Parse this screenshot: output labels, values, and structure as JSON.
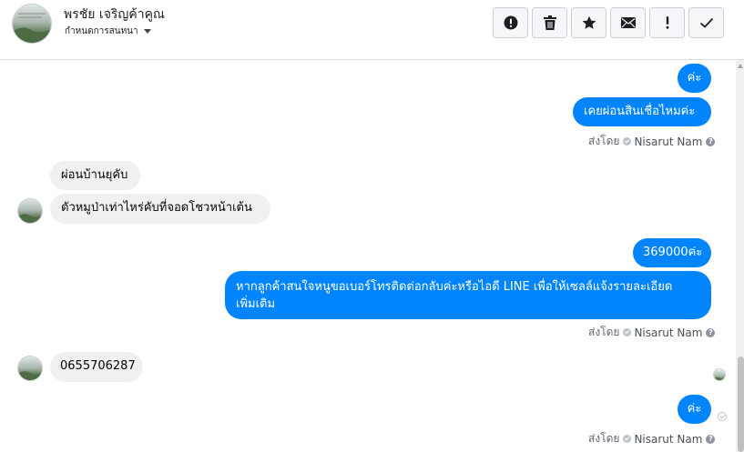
{
  "header": {
    "contact_name": "พรชัย เจริญค้าคูณ",
    "assign_label": "กำหนดการสนทนา",
    "toolbar": [
      {
        "icon": "exclamation-circle-icon",
        "name": "mark-important-button"
      },
      {
        "icon": "trash-icon",
        "name": "delete-button"
      },
      {
        "icon": "star-icon",
        "name": "star-button"
      },
      {
        "icon": "envelope-icon",
        "name": "mark-unread-button"
      },
      {
        "icon": "exclamation-icon",
        "name": "spam-button"
      },
      {
        "icon": "checkmark-icon",
        "name": "done-button"
      }
    ]
  },
  "sent_by": {
    "prefix": "ส่งโดย",
    "agent": "Nisarut Nam"
  },
  "messages": {
    "m1": "ค่ะ",
    "m2": "เคยผ่อนสินเชื่อไหมค่ะ",
    "m3": "ผ่อนบ้านยุคับ",
    "m4": "ตัวหมูป่าเท่าไหร่คับที่จอดโชวหน้าเต้น",
    "m5": "369000ค่ะ",
    "m6_line1": "หากลูกค้าสนใจหนูขอเบอร์โทรติดต่อกลับค่ะหรือไอดี LINE เพื่อให้เซลล์แจ้งรายละเอียด",
    "m6_line2": "เพิ่มเติม",
    "m7": "0655706287",
    "m8": "ค่ะ"
  },
  "colors": {
    "outgoing": "#0084ff",
    "incoming": "#f0f0f0"
  }
}
